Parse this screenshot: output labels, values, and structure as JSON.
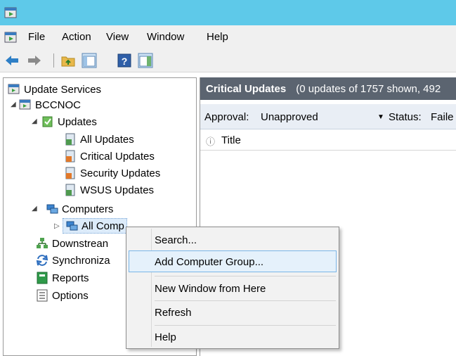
{
  "menubar": {
    "items": [
      "File",
      "Action",
      "View",
      "Window",
      "Help"
    ]
  },
  "toolbar": {
    "buttons": [
      "back-icon",
      "forward-icon",
      "up-folder-icon",
      "show-hide-tree-icon",
      "help-icon",
      "show-hide-action-pane-icon"
    ]
  },
  "tree": {
    "root": "Update Services",
    "server": "BCCNOC",
    "updates": "Updates",
    "all_updates": "All Updates",
    "critical_updates": "Critical Updates",
    "security_updates": "Security Updates",
    "wsus_updates": "WSUS Updates",
    "computers": "Computers",
    "all_computers": "All Comp",
    "downstream": "Downstrean",
    "synchronizations": "Synchroniza",
    "reports": "Reports",
    "options": "Options"
  },
  "right_pane": {
    "title": "Critical Updates",
    "subtitle": "(0 updates of 1757 shown, 492",
    "approval_label": "Approval:",
    "approval_value": "Unapproved",
    "status_label": "Status:",
    "status_value": "Faile",
    "column_title": "Title",
    "column_info_glyph": "ⓘ"
  },
  "context_menu": {
    "items": [
      "Search...",
      "Add Computer Group...",
      "New Window from Here",
      "Refresh",
      "Help"
    ],
    "highlighted": "Add Computer Group..."
  },
  "colors": {
    "titlebar": "#5ec9e9",
    "pane_header": "#5b6470",
    "menu_highlight": "#e5f1fb"
  }
}
